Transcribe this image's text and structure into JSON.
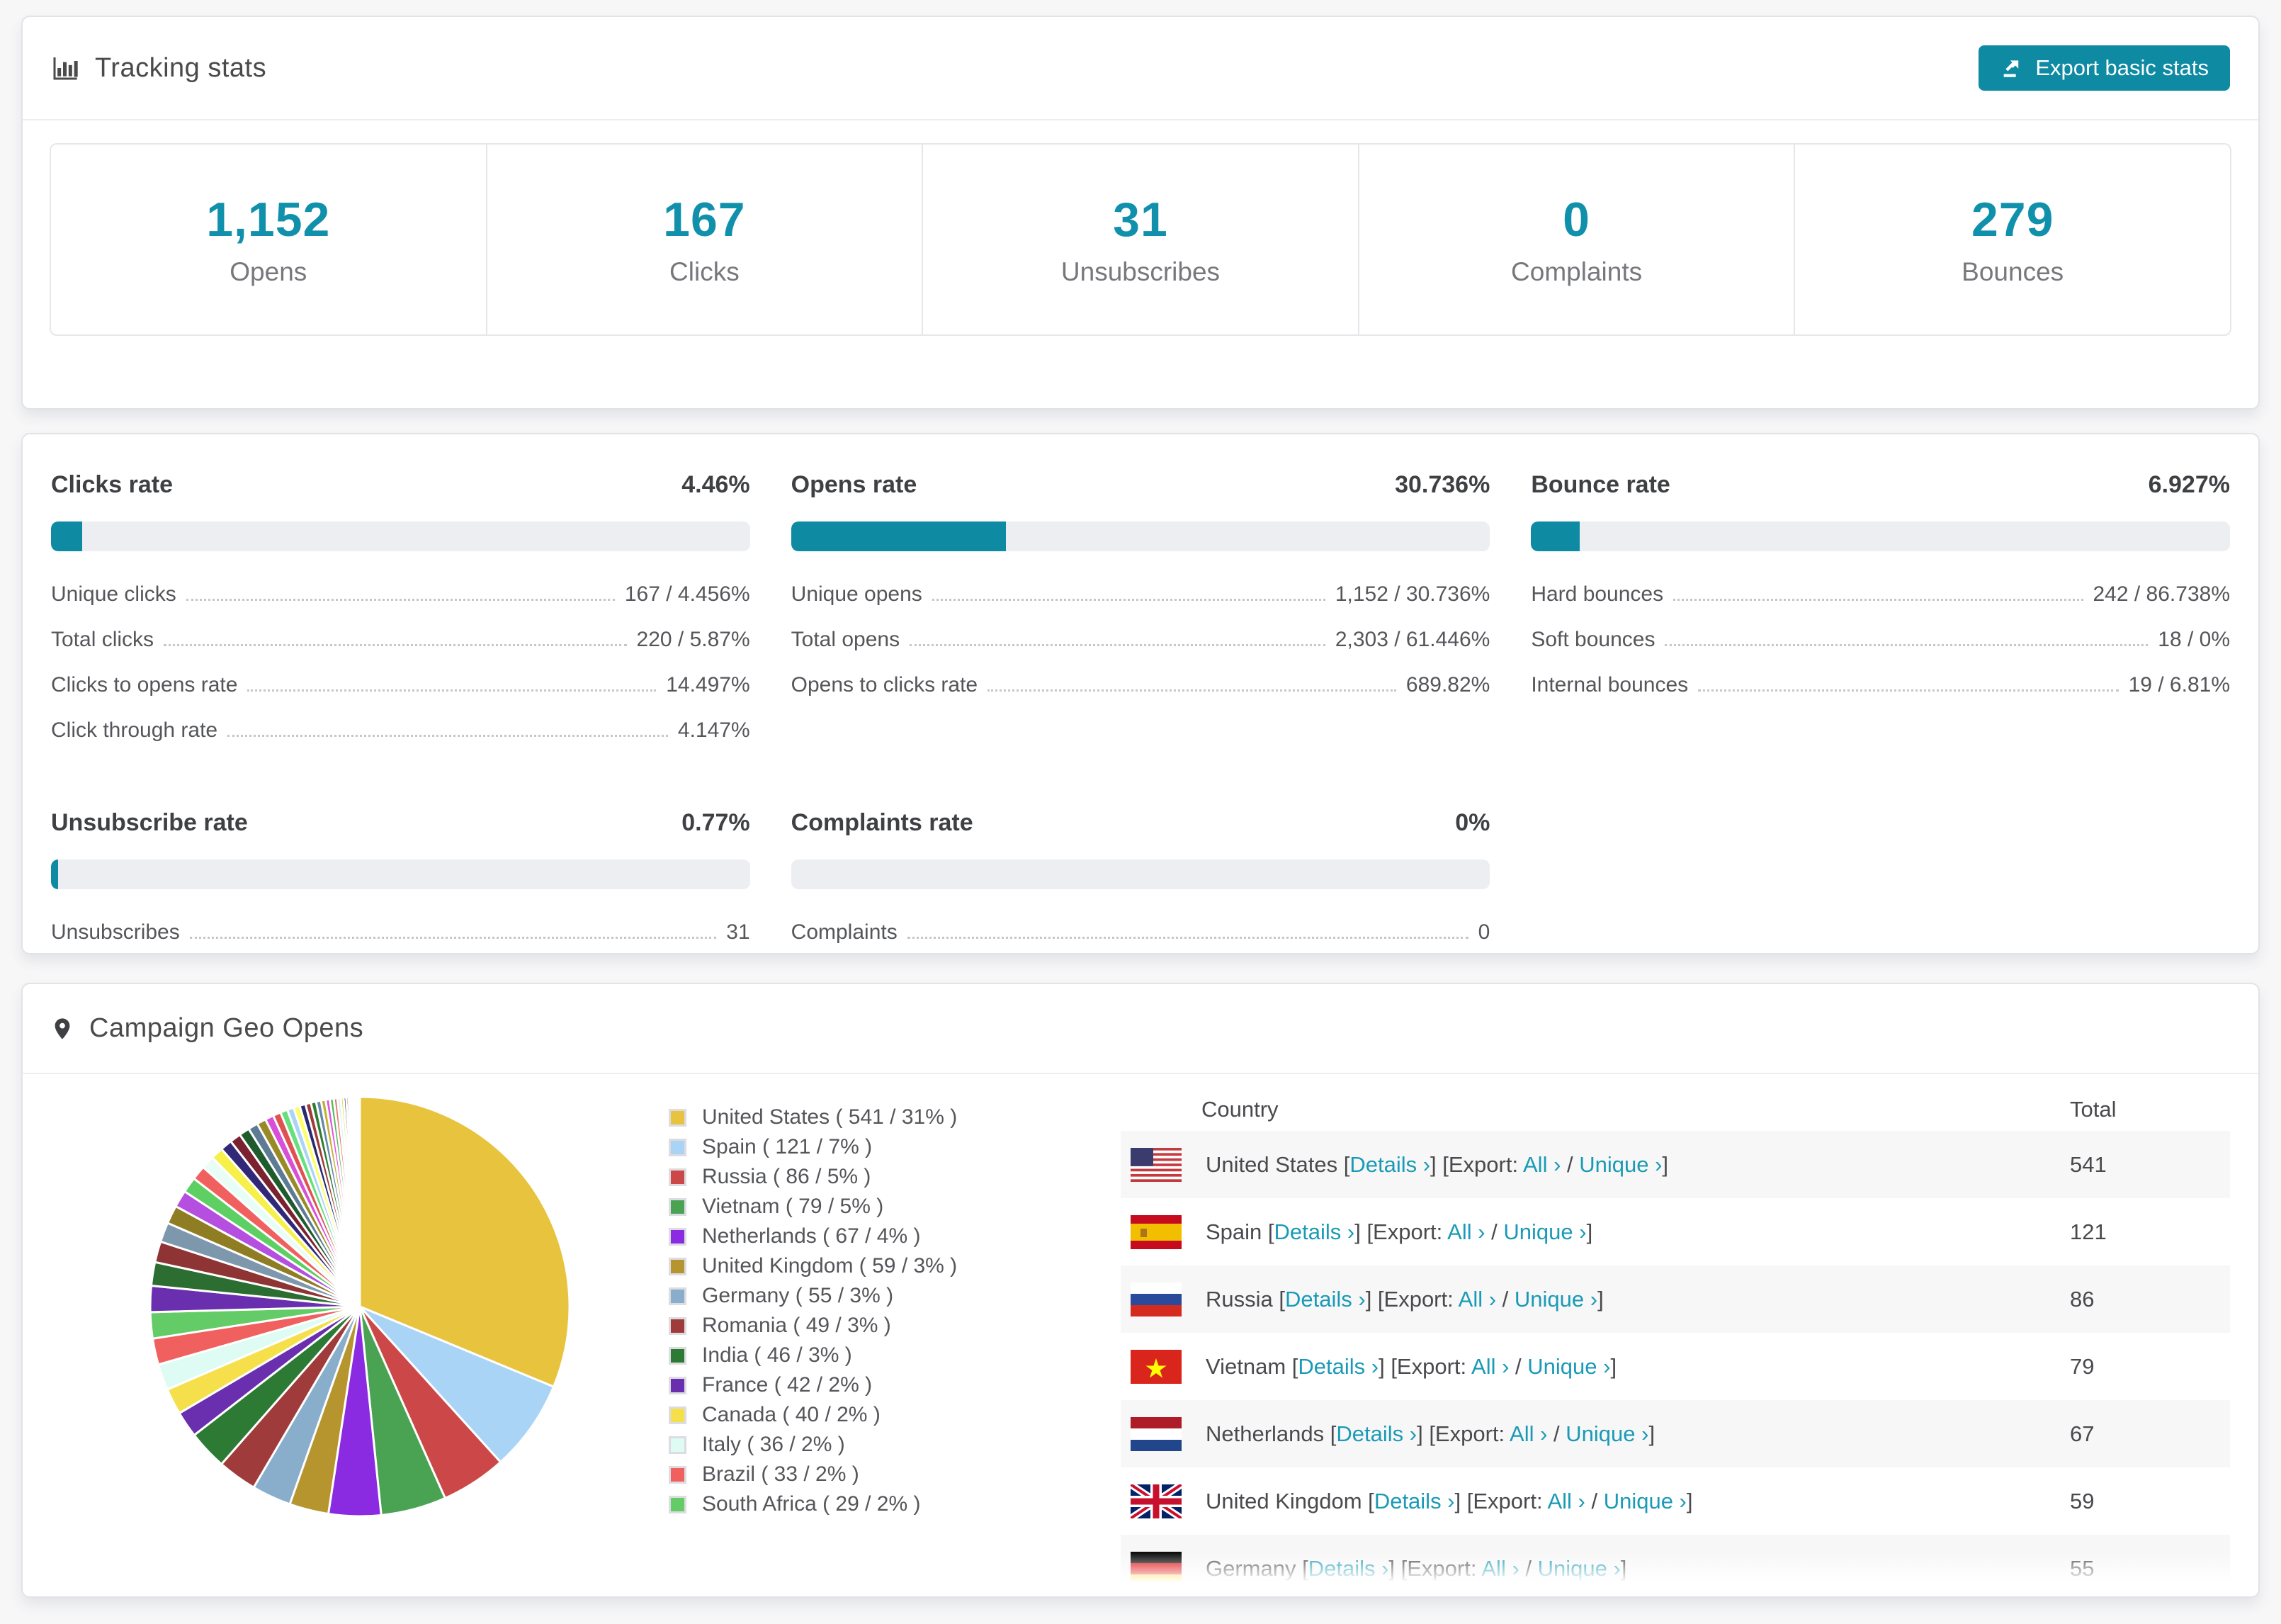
{
  "theme": {
    "teal": "#0e8ba3",
    "link_teal": "#1a9ab6",
    "text_dark": "#3f4043",
    "text_mid": "#55565a",
    "track_gray": "#eceef1"
  },
  "tracking": {
    "title": "Tracking stats",
    "export_label": "Export basic stats",
    "stats": [
      {
        "value": "1,152",
        "label": "Opens"
      },
      {
        "value": "167",
        "label": "Clicks"
      },
      {
        "value": "31",
        "label": "Unsubscribes"
      },
      {
        "value": "0",
        "label": "Complaints"
      },
      {
        "value": "279",
        "label": "Bounces"
      }
    ]
  },
  "rates": [
    {
      "title": "Clicks rate",
      "value": "4.46%",
      "pct": 4.46,
      "rows": [
        {
          "label": "Unique clicks",
          "value": "167 / 4.456%"
        },
        {
          "label": "Total clicks",
          "value": "220 / 5.87%"
        },
        {
          "label": "Clicks to opens rate",
          "value": "14.497%"
        },
        {
          "label": "Click through rate",
          "value": "4.147%"
        }
      ]
    },
    {
      "title": "Opens rate",
      "value": "30.736%",
      "pct": 30.736,
      "rows": [
        {
          "label": "Unique opens",
          "value": "1,152 / 30.736%"
        },
        {
          "label": "Total opens",
          "value": "2,303 / 61.446%"
        },
        {
          "label": "Opens to clicks rate",
          "value": "689.82%"
        }
      ]
    },
    {
      "title": "Bounce rate",
      "value": "6.927%",
      "pct": 6.927,
      "rows": [
        {
          "label": "Hard bounces",
          "value": "242 / 86.738%"
        },
        {
          "label": "Soft bounces",
          "value": "18 / 0%"
        },
        {
          "label": "Internal bounces",
          "value": "19 / 6.81%"
        }
      ]
    },
    {
      "title": "Unsubscribe rate",
      "value": "0.77%",
      "pct": 0.77,
      "rows": [
        {
          "label": "Unsubscribes",
          "value": "31"
        }
      ]
    },
    {
      "title": "Complaints rate",
      "value": "0%",
      "pct": 0,
      "rows": [
        {
          "label": "Complaints",
          "value": "0"
        }
      ]
    }
  ],
  "geo": {
    "title": "Campaign Geo Opens",
    "table": {
      "columns": [
        "Country",
        "Total"
      ],
      "links": {
        "details": "Details ›",
        "export_prefix": "[Export:",
        "all": "All ›",
        "slash": " / ",
        "unique": "Unique ›",
        "open_bracket": "[",
        "close_bracket": "]"
      },
      "rows": [
        {
          "country": "United States",
          "flag": "us",
          "total": "541"
        },
        {
          "country": "Spain",
          "flag": "es",
          "total": "121"
        },
        {
          "country": "Russia",
          "flag": "ru",
          "total": "86"
        },
        {
          "country": "Vietnam",
          "flag": "vn",
          "total": "79"
        },
        {
          "country": "Netherlands",
          "flag": "nl",
          "total": "67"
        },
        {
          "country": "United Kingdom",
          "flag": "gb",
          "total": "59"
        },
        {
          "country": "Germany",
          "flag": "de",
          "total": "55"
        }
      ]
    }
  },
  "chart_data": {
    "type": "pie",
    "title": "Campaign Geo Opens",
    "legend_position": "right",
    "value_unit": "opens (count / percent of total opens)",
    "slices": [
      {
        "label": "United States",
        "count": 541,
        "value": 31,
        "color": "#e8c33d"
      },
      {
        "label": "Spain",
        "count": 121,
        "value": 7,
        "color": "#aad4f5"
      },
      {
        "label": "Russia",
        "count": 86,
        "value": 5,
        "color": "#cc4748"
      },
      {
        "label": "Vietnam",
        "count": 79,
        "value": 5,
        "color": "#4aa353"
      },
      {
        "label": "Netherlands",
        "count": 67,
        "value": 4,
        "color": "#8a2be2"
      },
      {
        "label": "United Kingdom",
        "count": 59,
        "value": 3,
        "color": "#b6952e"
      },
      {
        "label": "Germany",
        "count": 55,
        "value": 3,
        "color": "#88aecb"
      },
      {
        "label": "Romania",
        "count": 49,
        "value": 3,
        "color": "#a03b3b"
      },
      {
        "label": "India",
        "count": 46,
        "value": 3,
        "color": "#2c7a33"
      },
      {
        "label": "France",
        "count": 42,
        "value": 2,
        "color": "#6a2fae"
      },
      {
        "label": "Canada",
        "count": 40,
        "value": 2,
        "color": "#f5e04b"
      },
      {
        "label": "Italy",
        "count": 36,
        "value": 2,
        "color": "#defcf4"
      },
      {
        "label": "Brazil",
        "count": 33,
        "value": 2,
        "color": "#f0605f"
      },
      {
        "label": "South Africa",
        "count": 29,
        "value": 2,
        "color": "#63cc66"
      }
    ],
    "other_slices": {
      "note": "many small unlabeled countries (~26% combined)",
      "values": [
        2.0,
        1.8,
        1.6,
        1.5,
        1.4,
        1.3,
        1.2,
        1.1,
        1.0,
        0.95,
        0.9,
        0.85,
        0.8,
        0.75,
        0.7,
        0.65,
        0.6,
        0.55,
        0.5,
        0.48,
        0.45,
        0.42,
        0.4,
        0.38,
        0.35,
        0.32,
        0.3,
        0.28,
        0.25,
        0.22,
        0.2,
        0.18,
        0.16,
        0.14,
        0.12,
        0.1,
        0.08,
        0.07,
        0.06,
        0.05,
        0.04,
        0.03
      ],
      "colors": [
        "#6a2fae",
        "#2c6e31",
        "#8e3434",
        "#7d97ad",
        "#8f7d24",
        "#b44fe0",
        "#5ecf63",
        "#f0605f",
        "#e8fdf6",
        "#f7ef4a",
        "#322878",
        "#7a2230",
        "#1f5b2d",
        "#5d7b94",
        "#9a8a26",
        "#d84fd8",
        "#e05252",
        "#66e07a",
        "#aad4f5",
        "#fdfd66",
        "#2a2a70",
        "#a03b3b",
        "#2e7d32",
        "#6688aa",
        "#c2b02e",
        "#e055e0",
        "#55bb55",
        "#ee7777",
        "#ccf5ee",
        "#eedd44",
        "#252566",
        "#8e3434",
        "#2c7a33",
        "#8a2be2",
        "#cc4748",
        "#63cc66",
        "#b6952e",
        "#f5e04b",
        "#88aecb",
        "#6a2fae",
        "#f0605f",
        "#aad4f5"
      ]
    },
    "legend_format": "{label} ( {count} / {value}% )"
  }
}
